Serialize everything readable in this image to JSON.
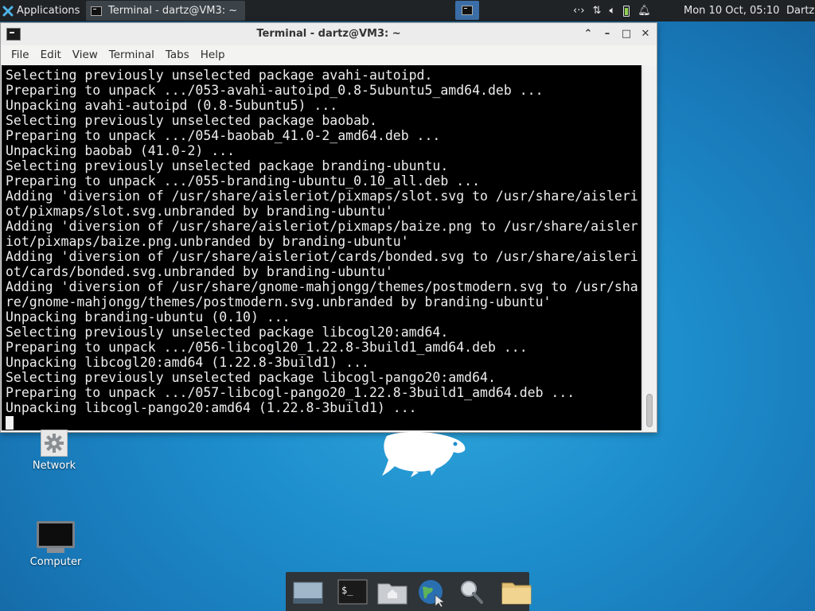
{
  "panel": {
    "applications_label": "Applications",
    "task_label": "Terminal - dartz@VM3: ~",
    "tray": {
      "network_icon": "network-arrows-icon",
      "transfer_icon": "updown-arrows-icon",
      "volume_icon": "speaker-icon",
      "battery_icon": "battery-icon",
      "notify_icon": "bell-icon"
    },
    "clock": "Mon 10 Oct, 05:10",
    "user": "Dartz"
  },
  "window": {
    "title": "Terminal - dartz@VM3: ~",
    "menus": [
      "File",
      "Edit",
      "View",
      "Terminal",
      "Tabs",
      "Help"
    ]
  },
  "terminal": {
    "lines": [
      "Selecting previously unselected package avahi-autoipd.",
      "Preparing to unpack .../053-avahi-autoipd_0.8-5ubuntu5_amd64.deb ...",
      "Unpacking avahi-autoipd (0.8-5ubuntu5) ...",
      "Selecting previously unselected package baobab.",
      "Preparing to unpack .../054-baobab_41.0-2_amd64.deb ...",
      "Unpacking baobab (41.0-2) ...",
      "Selecting previously unselected package branding-ubuntu.",
      "Preparing to unpack .../055-branding-ubuntu_0.10_all.deb ...",
      "Adding 'diversion of /usr/share/aisleriot/pixmaps/slot.svg to /usr/share/aisleri",
      "ot/pixmaps/slot.svg.unbranded by branding-ubuntu'",
      "Adding 'diversion of /usr/share/aisleriot/pixmaps/baize.png to /usr/share/aisler",
      "iot/pixmaps/baize.png.unbranded by branding-ubuntu'",
      "Adding 'diversion of /usr/share/aisleriot/cards/bonded.svg to /usr/share/aisleri",
      "ot/cards/bonded.svg.unbranded by branding-ubuntu'",
      "Adding 'diversion of /usr/share/gnome-mahjongg/themes/postmodern.svg to /usr/sha",
      "re/gnome-mahjongg/themes/postmodern.svg.unbranded by branding-ubuntu'",
      "Unpacking branding-ubuntu (0.10) ...",
      "Selecting previously unselected package libcogl20:amd64.",
      "Preparing to unpack .../056-libcogl20_1.22.8-3build1_amd64.deb ...",
      "Unpacking libcogl20:amd64 (1.22.8-3build1) ...",
      "Selecting previously unselected package libcogl-pango20:amd64.",
      "Preparing to unpack .../057-libcogl-pango20_1.22.8-3build1_amd64.deb ...",
      "Unpacking libcogl-pango20:amd64 (1.22.8-3build1) ..."
    ]
  },
  "desktop": {
    "icons": [
      {
        "label": "Network",
        "icon": "gear-icon"
      },
      {
        "label": "Computer",
        "icon": "monitor-icon"
      }
    ]
  },
  "dock": {
    "items": [
      "show-desktop-icon",
      "terminal-icon",
      "home-folder-icon",
      "web-browser-icon",
      "search-icon",
      "files-icon"
    ]
  },
  "colors": {
    "panel_bg": "#1f2326",
    "terminal_bg": "#000000",
    "terminal_fg": "#ededed",
    "desktop_blue": "#1e8fcd"
  }
}
